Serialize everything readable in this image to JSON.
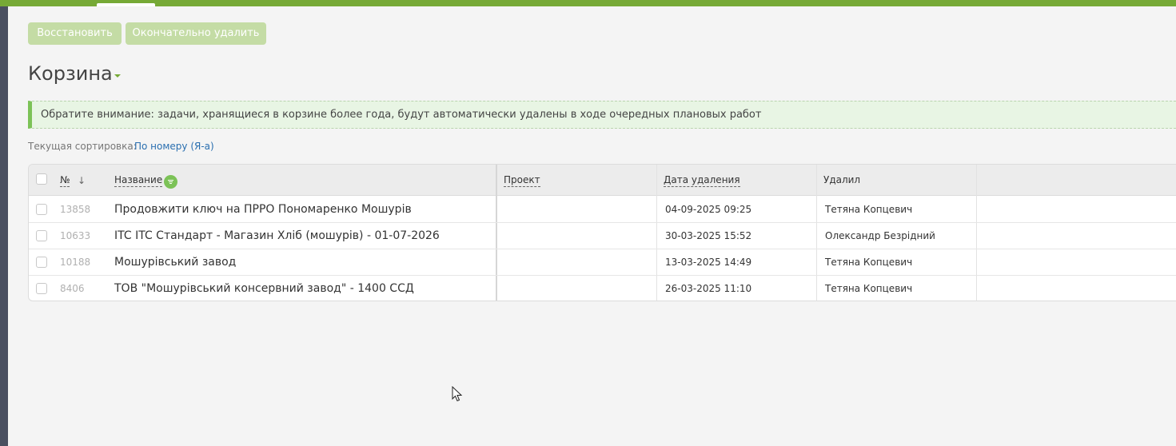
{
  "toolbar": {
    "restore_label": "Восстановить",
    "delete_label": "Окончательно удалить"
  },
  "page": {
    "title": "Корзина"
  },
  "notice": {
    "text": "Обратите внимание: задачи, хранящиеся в корзине более года, будут автоматически удалены в ходе очередных плановых работ"
  },
  "sorting": {
    "label": "Текущая сортировка:",
    "value": "По номеру (Я-а)"
  },
  "table": {
    "columns": {
      "number": "№",
      "name": "Название",
      "project": "Проект",
      "deleted_date": "Дата удаления",
      "deleted_by": "Удалил"
    },
    "rows": [
      {
        "number": "13858",
        "name": "Продовжити ключ на ПРРО Пономаренко Мошурів",
        "project": "",
        "deleted_date": "04-09-2025 09:25",
        "deleted_by": "Тетяна Копцевич"
      },
      {
        "number": "10633",
        "name": "ITC ITC Стандарт - Магазин Хліб (мошурів) - 01-07-2026",
        "project": "",
        "deleted_date": "30-03-2025 15:52",
        "deleted_by": "Олександр Безрідний"
      },
      {
        "number": "10188",
        "name": "Мошурівський завод",
        "project": "",
        "deleted_date": "13-03-2025 14:49",
        "deleted_by": "Тетяна Копцевич"
      },
      {
        "number": "8406",
        "name": "ТОВ \"Мошурівський консервний завод\" - 1400 ССД",
        "project": "",
        "deleted_date": "26-03-2025 11:10",
        "deleted_by": "Тетяна Копцевич"
      }
    ]
  },
  "colors": {
    "accent": "#76a936",
    "button_disabled": "#c4dca5",
    "notice_bg": "#e8f5e4",
    "link": "#2a6fb0"
  },
  "icons": {
    "sort": "arrow-down-icon",
    "filter": "filter-icon",
    "title_menu": "caret-down-icon",
    "cursor": "mouse-pointer-icon"
  }
}
